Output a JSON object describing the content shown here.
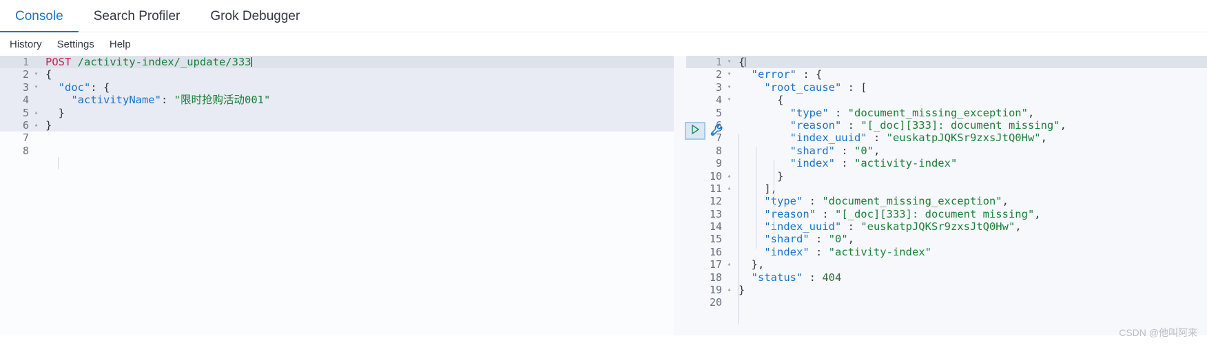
{
  "tabs": [
    {
      "label": "Console",
      "active": true
    },
    {
      "label": "Search Profiler",
      "active": false
    },
    {
      "label": "Grok Debugger",
      "active": false
    }
  ],
  "menu": [
    {
      "label": "History"
    },
    {
      "label": "Settings"
    },
    {
      "label": "Help"
    }
  ],
  "actions": {
    "play_icon": "play-icon",
    "wrench_icon": "wrench-icon"
  },
  "request_editor": {
    "lines": [
      {
        "n": "1",
        "fold": "",
        "current": true,
        "tokens": [
          {
            "t": "POST",
            "c": "k-method"
          },
          {
            "t": " ",
            "c": "k-punc"
          },
          {
            "t": "/activity-index/_update/333",
            "c": "k-url"
          }
        ],
        "caret": true
      },
      {
        "n": "2",
        "fold": "▾",
        "tokens": [
          {
            "t": "{",
            "c": "k-punc"
          }
        ]
      },
      {
        "n": "3",
        "fold": "▾",
        "tokens": [
          {
            "t": "  ",
            "c": "k-punc"
          },
          {
            "t": "\"doc\"",
            "c": "k-key"
          },
          {
            "t": ": {",
            "c": "k-punc"
          }
        ]
      },
      {
        "n": "4",
        "fold": "",
        "tokens": [
          {
            "t": "    ",
            "c": "k-punc"
          },
          {
            "t": "\"activityName\"",
            "c": "k-key"
          },
          {
            "t": ": ",
            "c": "k-punc"
          },
          {
            "t": "\"限时抢购活动001\"",
            "c": "k-str"
          }
        ]
      },
      {
        "n": "5",
        "fold": "▴",
        "tokens": [
          {
            "t": "  }",
            "c": "k-punc"
          }
        ]
      },
      {
        "n": "6",
        "fold": "▴",
        "tokens": [
          {
            "t": "}",
            "c": "k-punc"
          }
        ]
      },
      {
        "n": "7",
        "fold": "",
        "tokens": []
      },
      {
        "n": "8",
        "fold": "",
        "tokens": []
      }
    ]
  },
  "response_editor": {
    "lines": [
      {
        "n": "1",
        "fold": "▾",
        "current": true,
        "tokens": [
          {
            "t": "{",
            "c": "k-punc"
          }
        ],
        "caret": true
      },
      {
        "n": "2",
        "fold": "▾",
        "tokens": [
          {
            "t": "  ",
            "c": "k-punc"
          },
          {
            "t": "\"error\"",
            "c": "k-key"
          },
          {
            "t": " : {",
            "c": "k-punc"
          }
        ]
      },
      {
        "n": "3",
        "fold": "▾",
        "tokens": [
          {
            "t": "    ",
            "c": "k-punc"
          },
          {
            "t": "\"root_cause\"",
            "c": "k-key"
          },
          {
            "t": " : [",
            "c": "k-punc"
          }
        ]
      },
      {
        "n": "4",
        "fold": "▾",
        "tokens": [
          {
            "t": "      {",
            "c": "k-punc"
          }
        ]
      },
      {
        "n": "5",
        "fold": "",
        "tokens": [
          {
            "t": "        ",
            "c": "k-punc"
          },
          {
            "t": "\"type\"",
            "c": "k-key"
          },
          {
            "t": " : ",
            "c": "k-punc"
          },
          {
            "t": "\"document_missing_exception\"",
            "c": "k-str"
          },
          {
            "t": ",",
            "c": "k-punc"
          }
        ]
      },
      {
        "n": "6",
        "fold": "",
        "tokens": [
          {
            "t": "        ",
            "c": "k-punc"
          },
          {
            "t": "\"reason\"",
            "c": "k-key"
          },
          {
            "t": " : ",
            "c": "k-punc"
          },
          {
            "t": "\"[_doc][333]: document missing\"",
            "c": "k-str"
          },
          {
            "t": ",",
            "c": "k-punc"
          }
        ]
      },
      {
        "n": "7",
        "fold": "",
        "tokens": [
          {
            "t": "        ",
            "c": "k-punc"
          },
          {
            "t": "\"index_uuid\"",
            "c": "k-key"
          },
          {
            "t": " : ",
            "c": "k-punc"
          },
          {
            "t": "\"euskatpJQKSr9zxsJtQ0Hw\"",
            "c": "k-str"
          },
          {
            "t": ",",
            "c": "k-punc"
          }
        ]
      },
      {
        "n": "8",
        "fold": "",
        "tokens": [
          {
            "t": "        ",
            "c": "k-punc"
          },
          {
            "t": "\"shard\"",
            "c": "k-key"
          },
          {
            "t": " : ",
            "c": "k-punc"
          },
          {
            "t": "\"0\"",
            "c": "k-str"
          },
          {
            "t": ",",
            "c": "k-punc"
          }
        ]
      },
      {
        "n": "9",
        "fold": "",
        "tokens": [
          {
            "t": "        ",
            "c": "k-punc"
          },
          {
            "t": "\"index\"",
            "c": "k-key"
          },
          {
            "t": " : ",
            "c": "k-punc"
          },
          {
            "t": "\"activity-index\"",
            "c": "k-str"
          }
        ]
      },
      {
        "n": "10",
        "fold": "▴",
        "tokens": [
          {
            "t": "      }",
            "c": "k-punc"
          }
        ]
      },
      {
        "n": "11",
        "fold": "▴",
        "tokens": [
          {
            "t": "    ],",
            "c": "k-punc"
          }
        ]
      },
      {
        "n": "12",
        "fold": "",
        "tokens": [
          {
            "t": "    ",
            "c": "k-punc"
          },
          {
            "t": "\"type\"",
            "c": "k-key"
          },
          {
            "t": " : ",
            "c": "k-punc"
          },
          {
            "t": "\"document_missing_exception\"",
            "c": "k-str"
          },
          {
            "t": ",",
            "c": "k-punc"
          }
        ]
      },
      {
        "n": "13",
        "fold": "",
        "tokens": [
          {
            "t": "    ",
            "c": "k-punc"
          },
          {
            "t": "\"reason\"",
            "c": "k-key"
          },
          {
            "t": " : ",
            "c": "k-punc"
          },
          {
            "t": "\"[_doc][333]: document missing\"",
            "c": "k-str"
          },
          {
            "t": ",",
            "c": "k-punc"
          }
        ]
      },
      {
        "n": "14",
        "fold": "",
        "tokens": [
          {
            "t": "    ",
            "c": "k-punc"
          },
          {
            "t": "\"index_uuid\"",
            "c": "k-key"
          },
          {
            "t": " : ",
            "c": "k-punc"
          },
          {
            "t": "\"euskatpJQKSr9zxsJtQ0Hw\"",
            "c": "k-str"
          },
          {
            "t": ",",
            "c": "k-punc"
          }
        ]
      },
      {
        "n": "15",
        "fold": "",
        "tokens": [
          {
            "t": "    ",
            "c": "k-punc"
          },
          {
            "t": "\"shard\"",
            "c": "k-key"
          },
          {
            "t": " : ",
            "c": "k-punc"
          },
          {
            "t": "\"0\"",
            "c": "k-str"
          },
          {
            "t": ",",
            "c": "k-punc"
          }
        ]
      },
      {
        "n": "16",
        "fold": "",
        "tokens": [
          {
            "t": "    ",
            "c": "k-punc"
          },
          {
            "t": "\"index\"",
            "c": "k-key"
          },
          {
            "t": " : ",
            "c": "k-punc"
          },
          {
            "t": "\"activity-index\"",
            "c": "k-str"
          }
        ]
      },
      {
        "n": "17",
        "fold": "▴",
        "tokens": [
          {
            "t": "  },",
            "c": "k-punc"
          }
        ]
      },
      {
        "n": "18",
        "fold": "",
        "tokens": [
          {
            "t": "  ",
            "c": "k-punc"
          },
          {
            "t": "\"status\"",
            "c": "k-key"
          },
          {
            "t": " : ",
            "c": "k-punc"
          },
          {
            "t": "404",
            "c": "k-num"
          }
        ]
      },
      {
        "n": "19",
        "fold": "▴",
        "tokens": [
          {
            "t": "}",
            "c": "k-punc"
          }
        ]
      },
      {
        "n": "20",
        "fold": "",
        "tokens": []
      }
    ]
  },
  "watermark": "CSDN @他叫阿来",
  "colors": {
    "accent": "#1a73c9",
    "string": "#1a7f37",
    "key": "#1a73c9",
    "method": "#c7254e",
    "current_line": "#dee2eb"
  }
}
